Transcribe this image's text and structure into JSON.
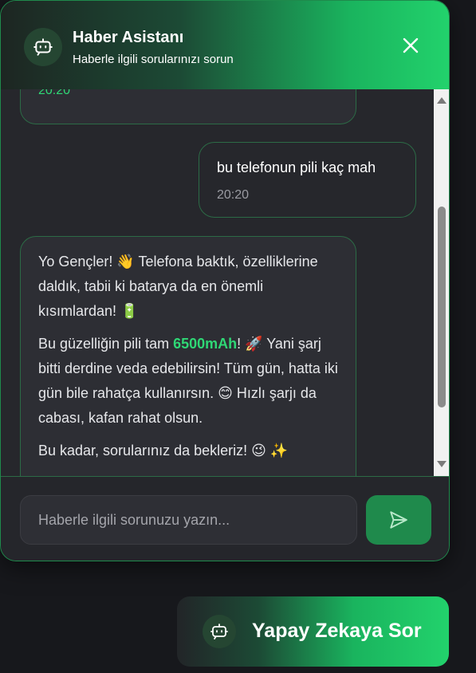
{
  "header": {
    "title": "Haber Asistanı",
    "subtitle": "Haberle ilgili sorularınızı sorun",
    "avatar_icon": "robot-icon",
    "close_icon": "close-icon"
  },
  "messages": [
    {
      "sender": "bot",
      "time": "20:20"
    },
    {
      "sender": "user",
      "text": "bu telefonun pili kaç mah",
      "time": "20:20"
    },
    {
      "sender": "bot",
      "p1_text": "Yo Gençler! 👋 Telefona baktık, özelliklerine daldık, tabii ki batarya da en önemli kısımlardan! 🔋",
      "p2_before": "Bu güzelliğin pili tam ",
      "p2_highlight": "6500mAh",
      "p2_after": "! 🚀 Yani şarj bitti derdine veda edebilirsin! Tüm gün, hatta iki gün bile rahatça kullanırsın. 😊 Hızlı şarjı da cabası, kafan rahat olsun.",
      "p3_text": "Bu kadar, sorularınız da bekleriz! 😉 ✨"
    }
  ],
  "input": {
    "placeholder": "Haberle ilgili sorunuzu yazın...",
    "value": ""
  },
  "send_icon": "send-icon",
  "fab": {
    "label": "Yapay Zekaya Sor",
    "icon": "robot-icon"
  },
  "colors": {
    "accent": "#22d26c",
    "accent_dark": "#1f8a4c",
    "background": "#26272c",
    "page_background": "#17181c"
  }
}
